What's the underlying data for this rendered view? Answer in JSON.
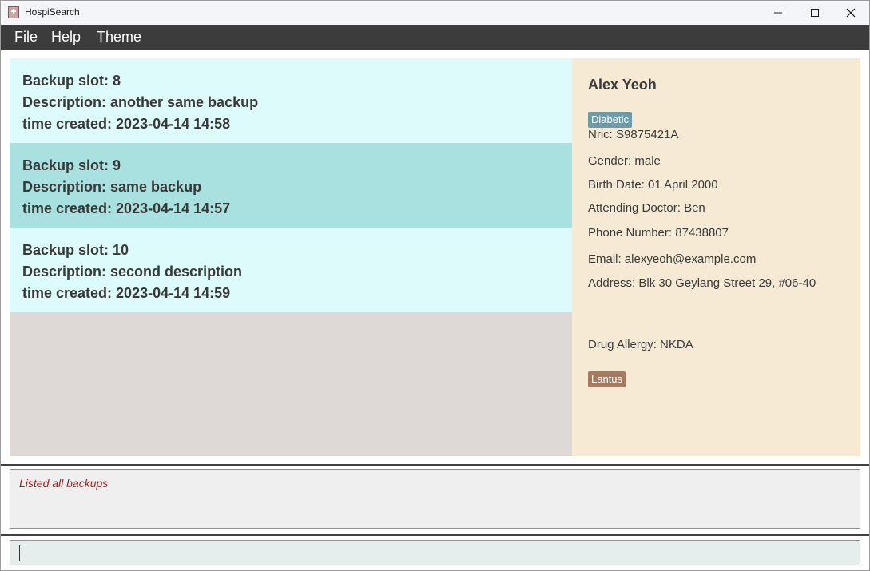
{
  "window": {
    "title": "HospiSearch"
  },
  "menu": {
    "items": [
      "File",
      "Help",
      "Theme"
    ]
  },
  "backups": [
    {
      "slot": "Backup slot: 8",
      "description": "Description: another same backup",
      "time": "time created: 2023-04-14 14:58"
    },
    {
      "slot": "Backup slot: 9",
      "description": "Description: same backup",
      "time": "time created: 2023-04-14 14:57"
    },
    {
      "slot": "Backup slot: 10",
      "description": "Description: second description",
      "time": "time created: 2023-04-14 14:59"
    }
  ],
  "patient": {
    "name": "Alex Yeoh",
    "tag": "Diabetic",
    "nric": "Nric: S9875421A",
    "gender": "Gender: male",
    "birth_date": "Birth Date: 01 April 2000",
    "doctor": "Attending Doctor: Ben",
    "phone": "Phone Number: 87438807",
    "email": "Email: alexyeoh@example.com",
    "address": "Address: Blk 30 Geylang Street 29, #06-40",
    "drug_allergy": "Drug Allergy: NKDA",
    "medicine": "Lantus"
  },
  "result": {
    "message": "Listed all backups"
  },
  "command": {
    "value": ""
  },
  "colors": {
    "menubar": "#3c3c3c",
    "card": "#dcfbfa",
    "card_selected": "#a9e0e0",
    "details_bg": "#f6ead5",
    "tag_diabetic": "#6f9aa7",
    "tag_medicine": "#a77a5f",
    "result_text": "#9b1d1d"
  }
}
